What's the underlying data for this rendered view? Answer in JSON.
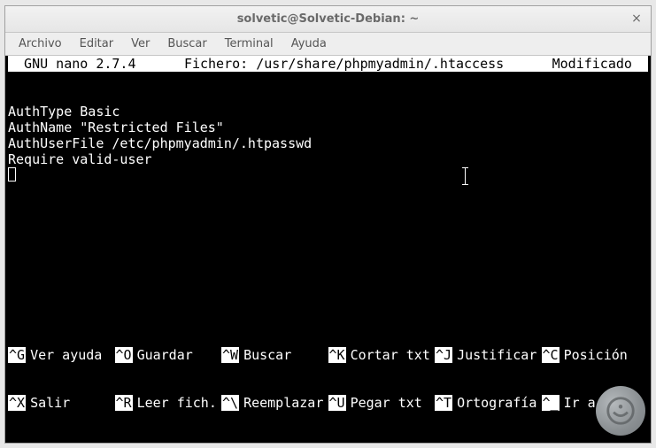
{
  "window": {
    "title": "solvetic@Solvetic-Debian: ~"
  },
  "menubar": [
    "Archivo",
    "Editar",
    "Ver",
    "Buscar",
    "Terminal",
    "Ayuda"
  ],
  "nano": {
    "version": "  GNU nano 2.7.4  ",
    "file_label": "Fichero: /usr/share/phpmyadmin/.htaccess",
    "status": "  Modificado  ",
    "content": [
      "AuthType Basic",
      "AuthName \"Restricted Files\"",
      "AuthUserFile /etc/phpmyadmin/.htpasswd",
      "Require valid-user"
    ],
    "shortcuts": [
      [
        {
          "key": "^G",
          "label": "Ver ayuda"
        },
        {
          "key": "^O",
          "label": "Guardar"
        },
        {
          "key": "^W",
          "label": "Buscar"
        },
        {
          "key": "^K",
          "label": "Cortar txt"
        },
        {
          "key": "^J",
          "label": "Justificar"
        },
        {
          "key": "^C",
          "label": "Posición"
        }
      ],
      [
        {
          "key": "^X",
          "label": "Salir"
        },
        {
          "key": "^R",
          "label": "Leer fich."
        },
        {
          "key": "^\\",
          "label": "Reemplazar"
        },
        {
          "key": "^U",
          "label": "Pegar txt"
        },
        {
          "key": "^T",
          "label": "Ortografía"
        },
        {
          "key": "^_",
          "label": "Ir a línea"
        }
      ]
    ]
  }
}
